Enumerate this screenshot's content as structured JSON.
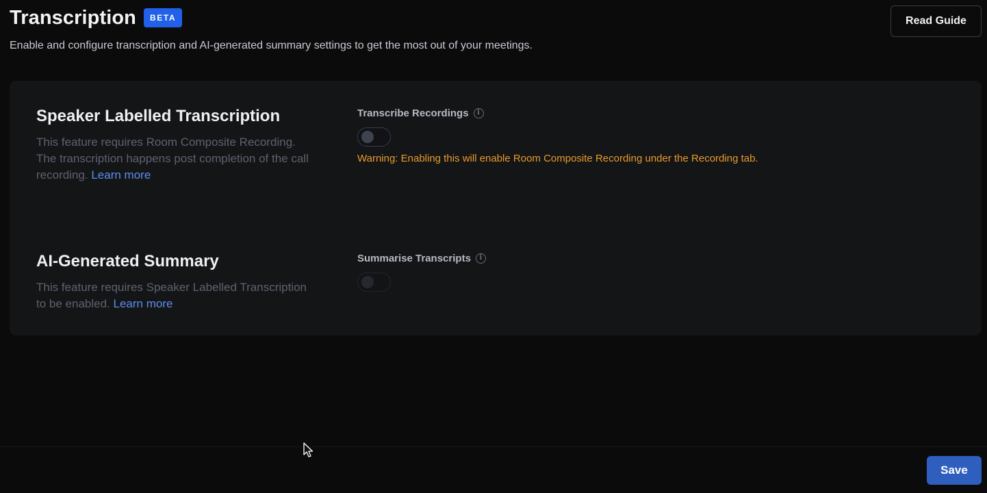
{
  "header": {
    "title": "Transcription",
    "badge": "BETA",
    "subtitle": "Enable and configure transcription and AI-generated summary settings to get the most out of your meetings.",
    "read_guide_label": "Read Guide"
  },
  "sections": [
    {
      "title": "Speaker Labelled Transcription",
      "description": "This feature requires Room Composite Recording. The transcription happens post completion of the call recording.",
      "learn_more": "Learn more",
      "field_label": "Transcribe Recordings",
      "toggle_on": false,
      "toggle_disabled": false,
      "warning": "Warning: Enabling this will enable Room Composite Recording under the Recording tab."
    },
    {
      "title": "AI-Generated Summary",
      "description": "This feature requires Speaker Labelled Transcription to be enabled.",
      "learn_more": "Learn more",
      "field_label": "Summarise Transcripts",
      "toggle_on": false,
      "toggle_disabled": true
    }
  ],
  "footer": {
    "save_label": "Save"
  },
  "colors": {
    "background": "#0b0b0c",
    "panel": "#141517",
    "accent": "#2160e8",
    "save_button": "#2e5fbf",
    "link": "#5c8ff0",
    "warning": "#e89b2c"
  },
  "icons": [
    "info-icon",
    "cursor-arrow-icon"
  ]
}
